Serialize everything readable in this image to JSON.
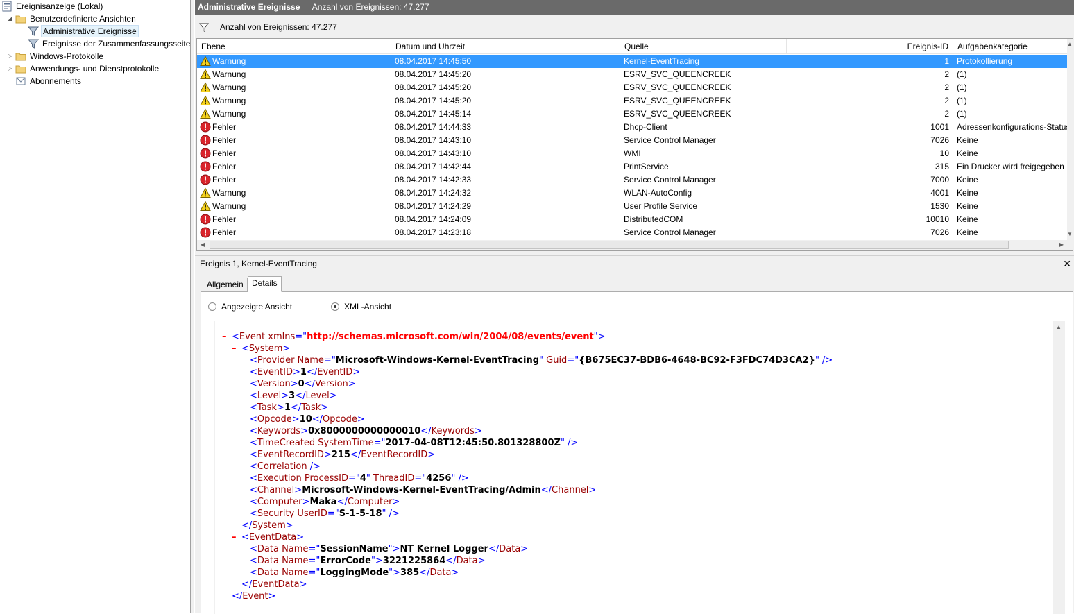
{
  "tree": {
    "root": "Ereignisanzeige (Lokal)",
    "custom_views": "Benutzerdefinierte Ansichten",
    "admin_events": "Administrative Ereignisse",
    "summary_events": "Ereignisse der Zusammenfassungsseite",
    "windows_logs": "Windows-Protokolle",
    "app_logs": "Anwendungs- und Dienstprotokolle",
    "subscriptions": "Abonnements"
  },
  "title": {
    "view_name": "Administrative Ereignisse",
    "count": "Anzahl von Ereignissen: 47.277"
  },
  "filter": {
    "text": "Anzahl von Ereignissen: 47.277"
  },
  "columns": {
    "level": "Ebene",
    "date": "Datum und Uhrzeit",
    "source": "Quelle",
    "id": "Ereignis-ID",
    "task": "Aufgabenkategorie"
  },
  "events": [
    {
      "level": "Warnung",
      "date": "08.04.2017 14:45:50",
      "source": "Kernel-EventTracing",
      "id": "1",
      "task": "Protokollierung"
    },
    {
      "level": "Warnung",
      "date": "08.04.2017 14:45:20",
      "source": "ESRV_SVC_QUEENCREEK",
      "id": "2",
      "task": "(1)"
    },
    {
      "level": "Warnung",
      "date": "08.04.2017 14:45:20",
      "source": "ESRV_SVC_QUEENCREEK",
      "id": "2",
      "task": "(1)"
    },
    {
      "level": "Warnung",
      "date": "08.04.2017 14:45:20",
      "source": "ESRV_SVC_QUEENCREEK",
      "id": "2",
      "task": "(1)"
    },
    {
      "level": "Warnung",
      "date": "08.04.2017 14:45:14",
      "source": "ESRV_SVC_QUEENCREEK",
      "id": "2",
      "task": "(1)"
    },
    {
      "level": "Fehler",
      "date": "08.04.2017 14:44:33",
      "source": "Dhcp-Client",
      "id": "1001",
      "task": "Adressenkonfigurations-Status"
    },
    {
      "level": "Fehler",
      "date": "08.04.2017 14:43:10",
      "source": "Service Control Manager",
      "id": "7026",
      "task": "Keine"
    },
    {
      "level": "Fehler",
      "date": "08.04.2017 14:43:10",
      "source": "WMI",
      "id": "10",
      "task": "Keine"
    },
    {
      "level": "Fehler",
      "date": "08.04.2017 14:42:44",
      "source": "PrintService",
      "id": "315",
      "task": "Ein Drucker wird freigegeben"
    },
    {
      "level": "Fehler",
      "date": "08.04.2017 14:42:33",
      "source": "Service Control Manager",
      "id": "7000",
      "task": "Keine"
    },
    {
      "level": "Warnung",
      "date": "08.04.2017 14:24:32",
      "source": "WLAN-AutoConfig",
      "id": "4001",
      "task": "Keine"
    },
    {
      "level": "Warnung",
      "date": "08.04.2017 14:24:29",
      "source": "User Profile Service",
      "id": "1530",
      "task": "Keine"
    },
    {
      "level": "Fehler",
      "date": "08.04.2017 14:24:09",
      "source": "DistributedCOM",
      "id": "10010",
      "task": "Keine"
    },
    {
      "level": "Fehler",
      "date": "08.04.2017 14:23:18",
      "source": "Service Control Manager",
      "id": "7026",
      "task": "Keine"
    }
  ],
  "detail": {
    "header": "Ereignis 1, Kernel-EventTracing",
    "close": "✕",
    "tab_general": "Allgemein",
    "tab_details": "Details",
    "radio_friendly": "Angezeigte Ansicht",
    "radio_xml": "XML-Ansicht"
  },
  "xml": {
    "event_open": "<Event xmlns=\"http://schemas.microsoft.com/win/2004/08/events/event\">",
    "provider_name": "Microsoft-Windows-Kernel-EventTracing",
    "provider_guid": "{B675EC37-BDB6-4648-BC92-F3FDC74D3CA2}",
    "event_id": "1",
    "version": "0",
    "level": "3",
    "task": "1",
    "opcode": "10",
    "keywords": "0x8000000000000010",
    "system_time": "2017-04-08T12:45:50.801328800Z",
    "record_id": "215",
    "process_id": "4",
    "thread_id": "4256",
    "channel": "Microsoft-Windows-Kernel-EventTracing/Admin",
    "computer": "Maka",
    "user_id": "S-1-5-18",
    "data": [
      {
        "name": "SessionName",
        "value": "NT Kernel Logger"
      },
      {
        "name": "ErrorCode",
        "value": "3221225864"
      },
      {
        "name": "LoggingMode",
        "value": "385"
      }
    ]
  },
  "colors": {
    "selection": "#3399ff",
    "title_bar": "#6a6a6a",
    "xml_tag": "#990000",
    "xml_bracket": "#0000ff"
  }
}
